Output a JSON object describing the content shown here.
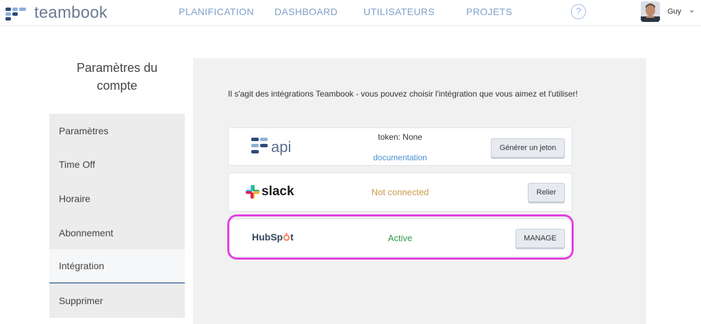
{
  "app": {
    "logo_text": "teambook"
  },
  "nav": {
    "items": [
      "PLANIFICATION",
      "DASHBOARD",
      "UTILISATEURS",
      "PROJETS"
    ],
    "help_glyph": "?",
    "user_name": "Guy",
    "user_chevron": "⌄"
  },
  "sidebar": {
    "title_line1": "Paramètres du",
    "title_line2": "compte",
    "items": [
      "Paramètres",
      "Time Off",
      "Horaire",
      "Abonnement",
      "Intégration",
      "Supprimer"
    ],
    "active_index": 4
  },
  "content": {
    "intro": "Il s'agit des intégrations Teambook - vous pouvez choisir l'intégration que vous aimez et l'utiliser!",
    "integrations": {
      "api": {
        "logo_text": "api",
        "token_text": "token: None",
        "doc_link": "documentation",
        "button": "Générer un jeton"
      },
      "slack": {
        "logo_text": "slack",
        "status": "Not connected",
        "status_color": "#c99a4a",
        "button": "Relier"
      },
      "hubspot": {
        "logo_text_a": "HubSp",
        "logo_text_b": "t",
        "status": "Active",
        "status_color": "#2f9a4a",
        "button": "MANAGE"
      }
    }
  },
  "colors": {
    "nav_link": "#7ea0c7",
    "highlight": "#e53ee0",
    "doc_link": "#4a8fd6"
  }
}
